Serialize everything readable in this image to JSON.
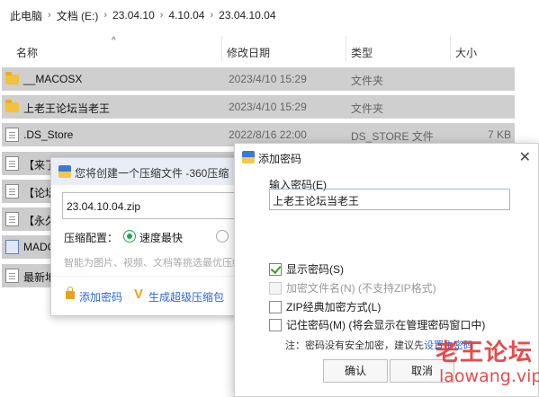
{
  "breadcrumb": [
    "此电脑",
    "文档 (E:)",
    "23.04.10",
    "4.10.04",
    "23.04.10.04"
  ],
  "columns": {
    "name": "名称",
    "modified": "修改日期",
    "type": "类型",
    "size": "大小"
  },
  "files": [
    {
      "name": "__MACOSX",
      "date": "2023/4/10 15:29",
      "type": "文件夹",
      "size": "",
      "icon": "folder-icon"
    },
    {
      "name": "上老王论坛当老王",
      "date": "2023/4/10 15:29",
      "type": "文件夹",
      "size": "",
      "icon": "folder-icon"
    },
    {
      "name": ".DS_Store",
      "date": "2022/8/16 22:00",
      "type": "DS_STORE 文件",
      "size": "7 KB",
      "icon": "file-icon"
    },
    {
      "name": "【来了",
      "icon": "document-icon"
    },
    {
      "name": "【论坛",
      "icon": "document-icon"
    },
    {
      "name": "【永久",
      "icon": "document-icon"
    },
    {
      "name": "MADO",
      "icon": "app-icon"
    },
    {
      "name": "最新地",
      "icon": "document-icon"
    }
  ],
  "zip_dialog": {
    "title": "您将创建一个压缩文件 -360压缩",
    "filename": "23.04.10.04.zip",
    "config_label": "压缩配置：",
    "speed_option": "速度最快",
    "hint": "智能为图片、视频、文档等挑选最优压缩",
    "add_password": "添加密码",
    "super_zip": "生成超级压缩包"
  },
  "password_dialog": {
    "title": "添加密码",
    "input_label": "输入密码(E)",
    "password_value": "上老王论坛当老王",
    "options": [
      {
        "label": "显示密码(S)",
        "checked": true,
        "disabled": false
      },
      {
        "label": "加密文件名(N) (不支持ZIP格式)",
        "checked": false,
        "disabled": true
      },
      {
        "label": "ZIP经典加密方式(L)",
        "checked": false,
        "disabled": false
      },
      {
        "label": "记住密码(M) (将会显示在管理密码窗口中)",
        "checked": false,
        "disabled": false
      }
    ],
    "note_prefix": "注：密码没有安全加密，建议先",
    "note_link": "设置主密码",
    "ok": "确认",
    "cancel": "取消"
  },
  "watermark": {
    "line1": "老王论坛",
    "line2": "laowang.vip"
  }
}
